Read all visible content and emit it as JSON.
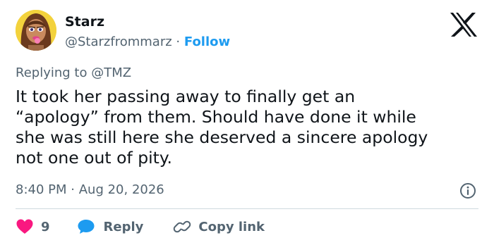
{
  "author": {
    "name": "Starz",
    "handle": "@Starzfrommarz",
    "separator": "·",
    "follow_label": "Follow"
  },
  "reply_context": {
    "prefix": "Replying to",
    "mention": "@TMZ"
  },
  "tweet": {
    "lines": [
      "It took her passing away to finally get an",
      "“apology” from them. Should have done it while",
      "she was still here she deserved a sincere apology",
      "not one out of pity."
    ],
    "time": "8:40 PM",
    "separator": "·",
    "date": "Aug 20, 2026"
  },
  "actions": {
    "like_count": "9",
    "reply_label": "Reply",
    "copy_link_label": "Copy link"
  },
  "colors": {
    "like": "#f91880",
    "reply": "#1d9bf0",
    "link": "#1d9bf0",
    "muted": "#536471",
    "text": "#0f1419",
    "divider": "#cfd9de"
  },
  "icons": {
    "platform": "x-logo-icon",
    "info": "info-icon",
    "like": "heart-icon",
    "reply": "speech-bubble-icon",
    "copy": "link-icon",
    "avatar": "avatar-doll-image"
  }
}
